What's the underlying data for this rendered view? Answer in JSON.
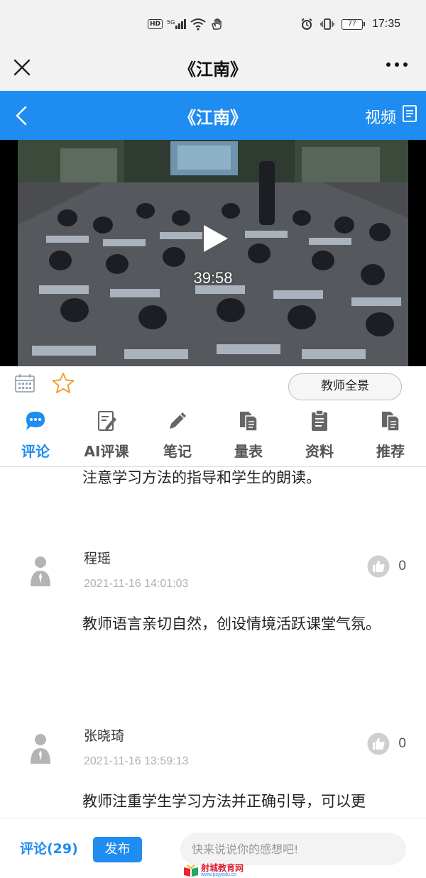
{
  "status_bar": {
    "network_badge": "HD",
    "signal": "5G",
    "battery": "77",
    "time": "17:35"
  },
  "title_bar": {
    "title": "《江南》",
    "close_icon": "close-icon",
    "more_icon": "more-icon"
  },
  "header": {
    "title": "《江南》",
    "video_label": "视频",
    "accent_color": "#1e8cf0"
  },
  "video": {
    "duration": "39:58"
  },
  "actions": {
    "teacher_panorama_label": "教师全景",
    "star_color": "#f0a030"
  },
  "tabs": [
    {
      "label": "评论",
      "icon": "comment-icon",
      "active": true
    },
    {
      "label": "AI评课",
      "icon": "ai-review-icon",
      "active": false
    },
    {
      "label": "笔记",
      "icon": "pencil-icon",
      "active": false
    },
    {
      "label": "量表",
      "icon": "scale-sheet-icon",
      "active": false
    },
    {
      "label": "资料",
      "icon": "clipboard-icon",
      "active": false
    },
    {
      "label": "推荐",
      "icon": "recommend-icon",
      "active": false
    }
  ],
  "comments": [
    {
      "text": "注意学习方法的指导和学生的朗读。"
    },
    {
      "name": "程瑶",
      "time": "2021-11-16 14:01:03",
      "likes": "0",
      "text": "教师语言亲切自然，创设情境活跃课堂气氛。"
    },
    {
      "name": "张晓琦",
      "time": "2021-11-16 13:59:13",
      "likes": "0",
      "text": "教师注重学生学习方法并正确引导，可以更"
    }
  ],
  "bottom_bar": {
    "comment_count_label": "评论(29)",
    "publish_label": "发布",
    "input_placeholder": "快来说说你的感想吧!",
    "watermark_text": "射城教育网",
    "watermark_url": "www.pcjyedu.cn"
  }
}
